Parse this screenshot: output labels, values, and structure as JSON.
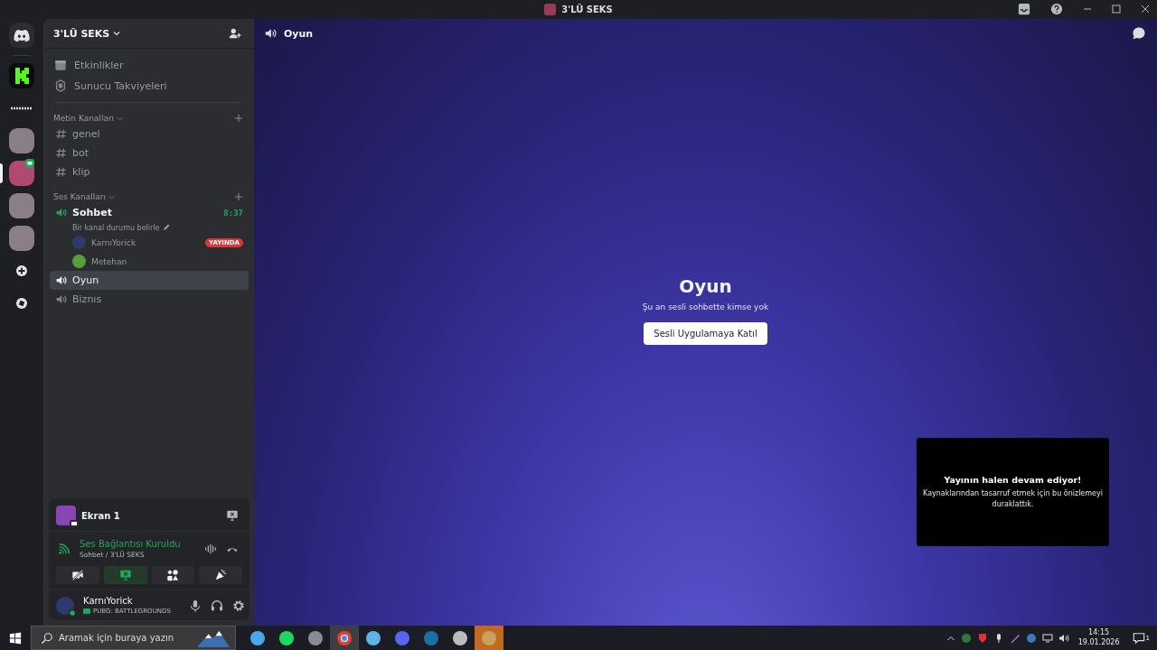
{
  "window": {
    "title": "3'LÜ SEKS"
  },
  "servers": [
    {
      "kind": "home",
      "selected": false
    },
    {
      "kind": "kick",
      "selected": false
    },
    {
      "kind": "wordmark",
      "selected": false
    },
    {
      "kind": "picture",
      "selected": false
    },
    {
      "kind": "picture",
      "selected": true
    },
    {
      "kind": "picture",
      "selected": false
    },
    {
      "kind": "picture",
      "selected": false
    },
    {
      "kind": "add",
      "selected": false
    },
    {
      "kind": "explore",
      "selected": false
    }
  ],
  "server": {
    "name": "3'LÜ SEKS"
  },
  "top_links": [
    {
      "kind": "calendar",
      "label": "Etkinlikler"
    },
    {
      "kind": "boost",
      "label": "Sunucu Takviyeleri"
    }
  ],
  "categories": [
    {
      "name": "Metin Kanalları",
      "channels": [
        {
          "kind": "text",
          "name": "genel",
          "selected": false,
          "connected": false
        },
        {
          "kind": "text",
          "name": "bot",
          "selected": false,
          "connected": false
        },
        {
          "kind": "text",
          "name": "klip",
          "selected": false,
          "connected": false
        }
      ]
    },
    {
      "name": "Ses Kanalları",
      "channels": [
        {
          "kind": "voice",
          "name": "Sohbet",
          "selected": false,
          "connected": true,
          "timer": "8:37",
          "status": "Bir kanal durumu belirle",
          "members": [
            {
              "name": "KarnıYorick",
              "badge": "YAYINDA"
            },
            {
              "name": "Metehan"
            }
          ]
        },
        {
          "kind": "voice",
          "name": "Oyun",
          "selected": true,
          "connected": false
        },
        {
          "kind": "voice",
          "name": "Biznıs",
          "selected": false,
          "connected": false
        }
      ]
    }
  ],
  "stream_panel": {
    "title": "Ekran 1"
  },
  "voice_panel": {
    "status": "Ses Bağlantısı Kuruldu",
    "location": "Sohbet / 3'LÜ SEKS",
    "actions": [
      {
        "kind": "camera",
        "on": false
      },
      {
        "kind": "screen",
        "on": true
      },
      {
        "kind": "activities",
        "on": false
      },
      {
        "kind": "soundboard",
        "on": false
      }
    ]
  },
  "user": {
    "name": "KarnıYorick",
    "activity": "PUBG: BATTLEGROUNDS"
  },
  "main": {
    "channel": "Oyun",
    "title": "Oyun",
    "subtitle": "Şu an sesli sohbette kimse yok",
    "join_button": "Sesli Uygulamaya Katıl"
  },
  "preview": {
    "title": "Yayının halen devam ediyor!",
    "text": "Kaynaklarından tasarruf etmek için bu önizlemeyi duraklattık."
  },
  "taskbar": {
    "search_placeholder": "Aramak için buraya yazın",
    "apps": [
      {
        "kind": "computer",
        "selected": false
      },
      {
        "kind": "spotify",
        "selected": false
      },
      {
        "kind": "picture",
        "selected": false
      },
      {
        "kind": "chrome",
        "selected": true
      },
      {
        "kind": "app",
        "selected": false
      },
      {
        "kind": "discord",
        "selected": false
      },
      {
        "kind": "steam",
        "selected": false
      },
      {
        "kind": "obs",
        "selected": false
      },
      {
        "kind": "pubg",
        "selected": true
      }
    ],
    "time": "14:15",
    "date": "19.01.2026",
    "notifications": "1"
  }
}
